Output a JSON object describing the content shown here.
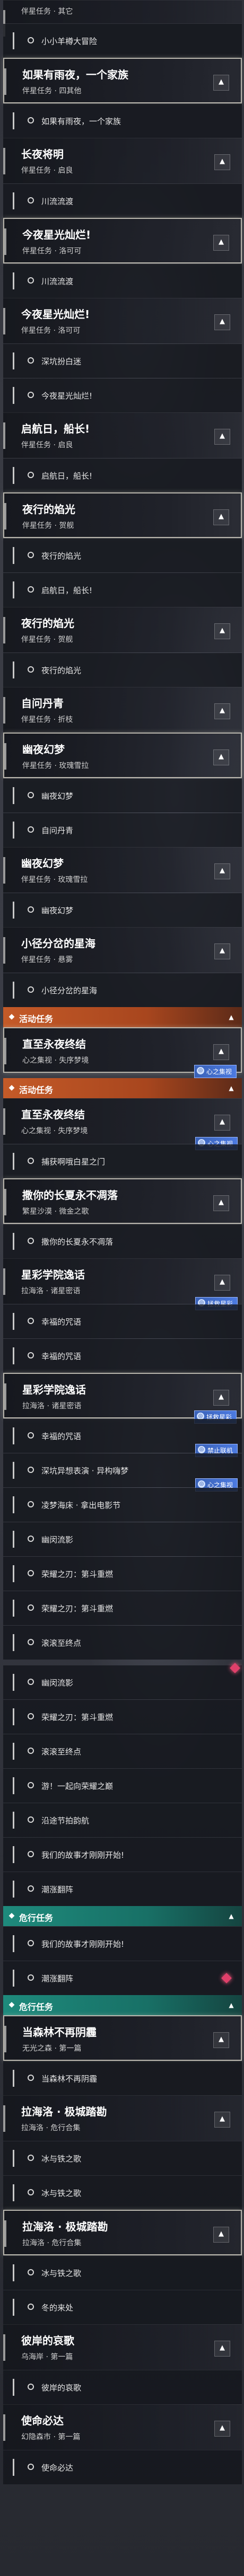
{
  "rows": [
    {
      "type": "sub",
      "label": "伴星任务 · 其它"
    },
    {
      "type": "row",
      "label": "小小羊樽大冒险"
    },
    {
      "type": "hdr",
      "title": "如果有雨夜，一个家族",
      "sub": "伴星任务 · 四其他",
      "hl": true
    },
    {
      "type": "row",
      "label": "如果有雨夜，一个家族"
    },
    {
      "type": "hdr",
      "title": "长夜将明",
      "sub": "伴星任务 · 启良"
    },
    {
      "type": "row",
      "label": "川流流渡"
    },
    {
      "type": "hdr",
      "title": "今夜星光灿烂!",
      "sub": "伴星任务 · 洛可可",
      "hl": true
    },
    {
      "type": "row",
      "label": "川流流渡"
    },
    {
      "type": "hdr",
      "title": "今夜星光灿烂!",
      "sub": "伴星任务 · 洛可可"
    },
    {
      "type": "row",
      "label": "深坑扮白迷"
    },
    {
      "type": "row",
      "label": "今夜星光灿烂!"
    },
    {
      "type": "hdr",
      "title": "启航日，船长!",
      "sub": "伴星任务 · 启良"
    },
    {
      "type": "row",
      "label": "启航日，船长!"
    },
    {
      "type": "hdr",
      "title": "夜行的焰光",
      "sub": "伴星任务 · 贺舰",
      "hl": true
    },
    {
      "type": "row",
      "label": "夜行的焰光"
    },
    {
      "type": "row",
      "label": "启航日，船长!"
    },
    {
      "type": "hdr",
      "title": "夜行的焰光",
      "sub": "伴星任务 · 贺舰"
    },
    {
      "type": "row",
      "label": "夜行的焰光"
    },
    {
      "type": "hdr",
      "title": "自问丹青",
      "sub": "伴星任务 · 折枝"
    },
    {
      "type": "hdr",
      "title": "幽夜幻梦",
      "sub": "伴星任务 · 玫瑰雪拉",
      "hl": true
    },
    {
      "type": "row",
      "label": "幽夜幻梦"
    },
    {
      "type": "row",
      "label": "自问丹青"
    },
    {
      "type": "hdr",
      "title": "幽夜幻梦",
      "sub": "伴星任务 · 玫瑰雪拉"
    },
    {
      "type": "row",
      "label": "幽夜幻梦"
    },
    {
      "type": "hdr",
      "title": "小径分岔的星海",
      "sub": "伴星任务 · 悬雾"
    },
    {
      "type": "row",
      "label": "小径分岔的星海"
    },
    {
      "type": "grp",
      "color": "orange",
      "label": "活动任务"
    },
    {
      "type": "hdr",
      "title": "直至永夜终结",
      "sub": "心之集视 · 失序梦境",
      "badge": "心之集视",
      "hl": true
    },
    {
      "type": "gap"
    },
    {
      "type": "grp",
      "color": "orange",
      "label": "活动任务"
    },
    {
      "type": "hdr",
      "title": "直至永夜终结",
      "sub": "心之集视 · 失序梦境",
      "badge": "心之集视"
    },
    {
      "type": "row",
      "label": "捕获啊哦白星之门"
    },
    {
      "type": "hdr",
      "title": "撒你的长夏永不凋落",
      "sub": "繁星沙漠 · 微金之歌",
      "hl": true
    },
    {
      "type": "row",
      "label": "撒你的长夏永不凋落"
    },
    {
      "type": "hdr",
      "title": "星彩学院逸话",
      "sub": "拉海洛 · 诸星密语",
      "badge": "拯救星彩"
    },
    {
      "type": "row",
      "label": "幸福的咒语"
    },
    {
      "type": "row",
      "label": "幸福的咒语"
    },
    {
      "type": "hdr",
      "title": "星彩学院逸话",
      "sub": "拉海洛 · 诸星密语",
      "badge": "拯救星彩",
      "hl": true
    },
    {
      "type": "row",
      "label": "幸福的咒语",
      "badge": "禁止联机"
    },
    {
      "type": "row",
      "label": "深坑异想表演 · 异构嗨梦",
      "badge": "心之集视"
    },
    {
      "type": "row",
      "label": "凌梦海床 · 拿出电影节"
    },
    {
      "type": "row",
      "label": "幽闵流影"
    },
    {
      "type": "row",
      "label": "荣耀之刃：第斗重燃"
    },
    {
      "type": "row",
      "label": "荣耀之刃：第斗重燃"
    },
    {
      "type": "row",
      "label": "滚滚至终点"
    },
    {
      "type": "gap"
    },
    {
      "type": "row",
      "label": "幽闵流影"
    },
    {
      "type": "row",
      "label": "荣耀之刃：第斗重燃"
    },
    {
      "type": "row",
      "label": "滚滚至终点"
    },
    {
      "type": "row",
      "label": "游！一起向荣耀之巅"
    },
    {
      "type": "row",
      "label": "沿途节拍韵航"
    },
    {
      "type": "row",
      "label": "我们的故事才刚刚开始!"
    },
    {
      "type": "row",
      "label": "潮涨翻阵"
    },
    {
      "type": "grp",
      "color": "teal",
      "label": "危行任务"
    },
    {
      "type": "row",
      "label": "我们的故事才刚刚开始!"
    },
    {
      "type": "row",
      "label": "潮涨翻阵"
    },
    {
      "type": "grp",
      "color": "teal",
      "label": "危行任务"
    },
    {
      "type": "hdr",
      "title": "当森林不再阴霾",
      "sub": "无光之森 · 第一篇",
      "hl": true
    },
    {
      "type": "row",
      "label": "当森林不再阴霾"
    },
    {
      "type": "hdr",
      "title": "拉海洛 · 极城踏勘",
      "sub": "拉海洛 · 危行合集"
    },
    {
      "type": "row",
      "label": "冰与铁之歌"
    },
    {
      "type": "row",
      "label": "冰与铁之歌"
    },
    {
      "type": "hdr",
      "title": "拉海洛 · 极城踏勘",
      "sub": "拉海洛 · 危行合集",
      "hl": true
    },
    {
      "type": "row",
      "label": "冰与铁之歌"
    },
    {
      "type": "row",
      "label": "冬的来处"
    },
    {
      "type": "hdr",
      "title": "彼岸的哀歌",
      "sub": "乌海岸 · 第一篇"
    },
    {
      "type": "row",
      "label": "彼岸的哀歌"
    },
    {
      "type": "hdr",
      "title": "使命必达",
      "sub": "幻隐森市 · 第一篇"
    },
    {
      "type": "row",
      "label": "使命必达"
    }
  ],
  "icons": {
    "chevron": "chevron-up-icon",
    "circle": "circle-icon",
    "group": "activity-icon"
  }
}
